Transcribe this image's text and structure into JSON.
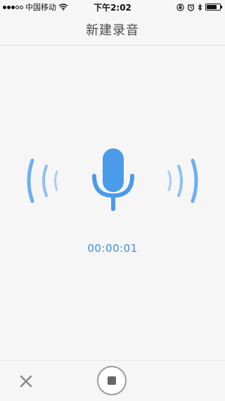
{
  "status_bar": {
    "carrier": "中国移动",
    "time": "下午2:02",
    "signal_bars_filled": 3,
    "signal_bars_total": 5,
    "battery_level": 0.8
  },
  "nav": {
    "title": "新建录音"
  },
  "recorder": {
    "elapsed": "00:00:01",
    "accent_color": "#4a9be8",
    "icons": [
      "microphone-icon",
      "sound-wave-left-icon",
      "sound-wave-right-icon"
    ]
  },
  "toolbar": {
    "close_icon": "close-icon",
    "stop_icon": "stop-icon"
  }
}
